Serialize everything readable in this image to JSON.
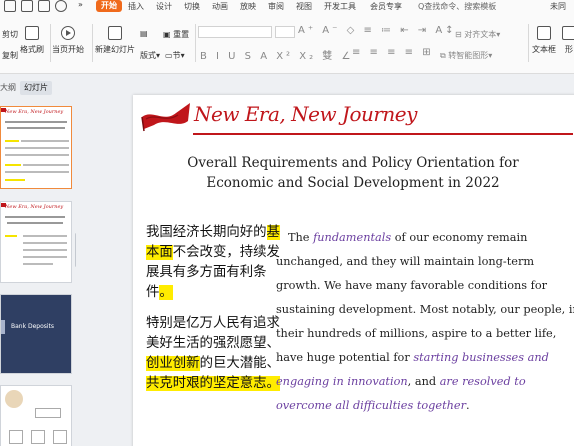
{
  "ribbon": {
    "menu_tabs": {
      "home": "开始",
      "insert": "插入",
      "design": "设计",
      "transitions": "切换",
      "animations": "动画",
      "slideshow": "放映",
      "review": "审阅",
      "view": "视图",
      "developer": "开发工具",
      "member": "会员专享"
    },
    "search_label": "Q查找命令、搜索模板",
    "save_status": "未同",
    "tools": {
      "cut": "剪切",
      "copy": "复制",
      "format_painter": "格式刷",
      "play_from_current": "当页开始",
      "new_slide": "新建幻灯片",
      "layout": "版式",
      "section": "节",
      "reset": "重置",
      "align_text": "对齐文本",
      "convert_smartart": "转智能图形",
      "textbox": "文本框",
      "shapes": "形"
    },
    "font_row_glyphs": "A⁺ A⁻ ◇ ≡ ≔ ⇤ ⇥ A↕",
    "style_row_glyphs": "B I U S A X² X₂ 雙 ∠"
  },
  "left_pane": {
    "tab_outline": "大纲",
    "tab_slides": "幻灯片",
    "thumb3_text": "Bank Deposits"
  },
  "slide": {
    "brand": "New Era, New Journey",
    "title_line1": "Overall Requirements and Policy Orientation for",
    "title_line2": "Economic and Social Development in 2022",
    "cn": {
      "p1_a": "我国经济长期向好的",
      "p1_hl1": "基本面",
      "p1_b": "不会改变，持续发展具有多方面有利条件",
      "p1_c": "。",
      "p2_a": "特别是亿万人民有追求美好生活的强烈愿望、",
      "p2_hl1": "创业创新",
      "p2_b": "的巨大潜能、",
      "p2_hl2": "共克时艰的坚定意志",
      "p2_c": "。"
    },
    "en": {
      "s1": "The ",
      "e1": "fundamentals",
      "s2": " of our economy remain unchanged, and they will maintain long-term growth. We have many favorable conditions for sustaining development. Most notably, our people, in their hundreds of millions, aspire to a better life, have huge potential for ",
      "e2": "starting businesses and engaging in innovation",
      "s3": ", and ",
      "e3": "are resolved to overcome all difficulties together",
      "s4": "."
    }
  },
  "colors": {
    "brand_red": "#c0161b",
    "highlight": "#ffec00",
    "emphasis_purple": "#6b3fa0",
    "active_tab_orange": "#f06a1c"
  }
}
